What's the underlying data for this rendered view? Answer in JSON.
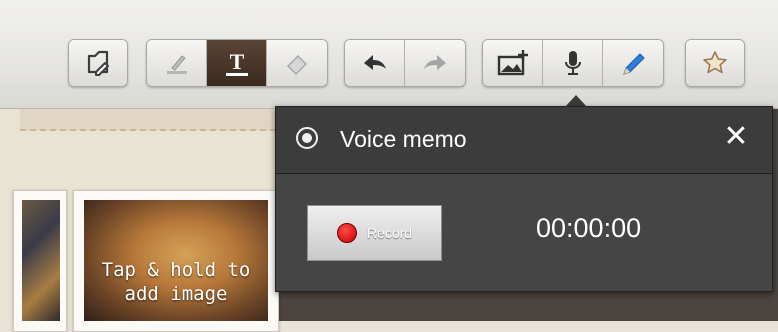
{
  "toolbar": {
    "groups": [
      {
        "name": "edit",
        "buttons": [
          {
            "icon": "edit-page-icon"
          }
        ]
      },
      {
        "name": "text-tools",
        "buttons": [
          {
            "icon": "highlighter-icon"
          },
          {
            "icon": "text-tool-icon",
            "glyph": "T",
            "active": true
          },
          {
            "icon": "eraser-icon"
          }
        ]
      },
      {
        "name": "history",
        "buttons": [
          {
            "icon": "undo-icon"
          },
          {
            "icon": "redo-icon"
          }
        ]
      },
      {
        "name": "insert",
        "buttons": [
          {
            "icon": "add-image-icon"
          },
          {
            "icon": "microphone-icon"
          },
          {
            "icon": "pen-icon"
          }
        ]
      },
      {
        "name": "favorite",
        "buttons": [
          {
            "icon": "star-icon"
          }
        ]
      }
    ]
  },
  "canvas": {
    "placeholder_text_line1": "Tap & hold to",
    "placeholder_text_line2": "add image"
  },
  "voice_memo": {
    "title": "Voice memo",
    "close_label": "✕",
    "record_label": "Record",
    "timer": "00:00:00"
  },
  "colors": {
    "popup_bg": "#3a3a3a",
    "record_dot": "#e00000",
    "active_tool": "#4a3628",
    "pen_blue": "#2c7fd8"
  }
}
